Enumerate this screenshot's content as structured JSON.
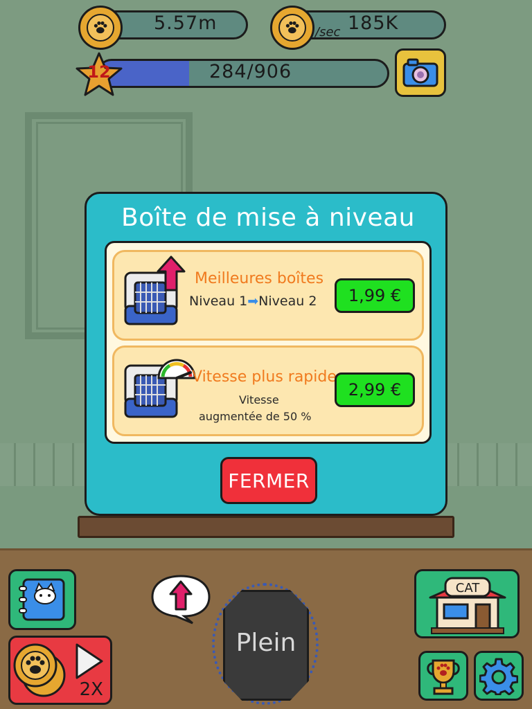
{
  "hud": {
    "money": "5.57m",
    "rate_unit": "/sec",
    "rate_value": "185K",
    "level": "12",
    "xp_text": "284/906",
    "xp_progress": 0.313
  },
  "modal": {
    "title": "Boîte de mise à niveau",
    "items": [
      {
        "title": "Meilleures boîtes",
        "sub_from": "Niveau 1",
        "sub_arrow": "➡",
        "sub_to": "Niveau 2",
        "price": "1,99 €",
        "icon": "red-up-arrow-icon"
      },
      {
        "title": "Vitesse plus rapide",
        "sub_line1": "Vitesse",
        "sub_line2": "augmentée de 50 %",
        "price": "2,99 €",
        "icon": "speed-gauge-icon"
      }
    ],
    "close_label": "FERMER"
  },
  "bottom": {
    "box_label": "Plein",
    "boost_label": "2X",
    "shop_sign": "CAT"
  },
  "colors": {
    "modal_bg": "#2bbcc9",
    "price_green": "#1fe020",
    "close_red": "#f0303a",
    "card_title_orange": "#f07a1e",
    "xp_fill": "#4a64c8"
  }
}
